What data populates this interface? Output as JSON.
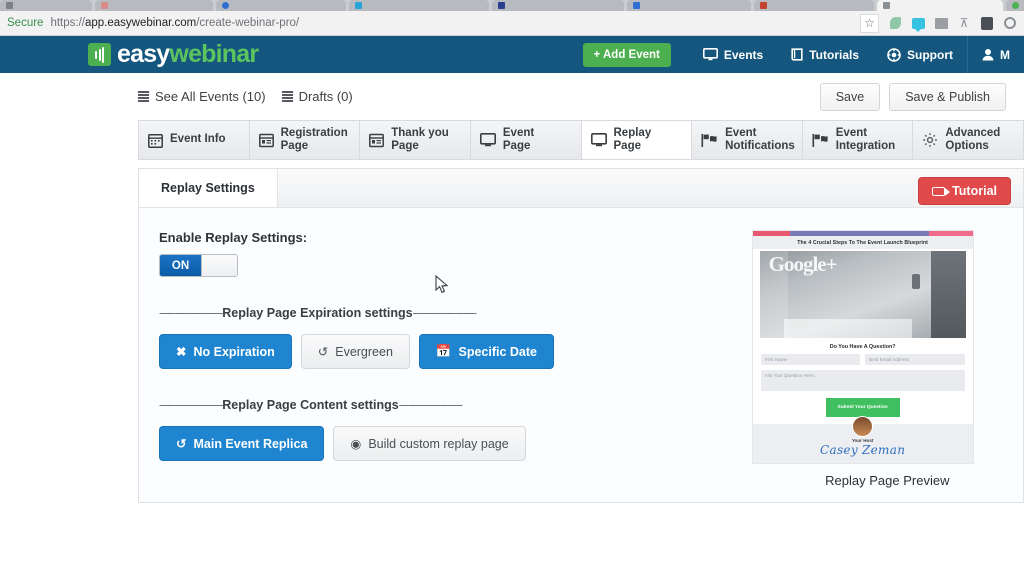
{
  "browser": {
    "tabs": [
      {
        "title": "",
        "favicon_color": "#7b8186"
      },
      {
        "title": "",
        "favicon_color": "#d98b8b"
      },
      {
        "title": "",
        "favicon_color": "#2f6fd0"
      },
      {
        "title": "",
        "favicon_color": "#29a3d8"
      },
      {
        "title": "",
        "favicon_color": "#2a3f8f"
      },
      {
        "title": "",
        "favicon_color": "#2f6fd0"
      },
      {
        "title": "",
        "favicon_color": "#c4452f"
      },
      {
        "title": "",
        "favicon_color": "#8a8f94"
      },
      {
        "title": "",
        "favicon_color": "#4caf50"
      },
      {
        "title": "",
        "favicon_color": "#8a8f94"
      },
      {
        "title": "",
        "favicon_color": "#8a8f94"
      }
    ],
    "security_label": "Secure",
    "url_scheme": "https://",
    "url_host": "app.easywebinar.com",
    "url_path": "/create-webinar-pro/",
    "icons": [
      "star-icon",
      "leaf-extension-icon",
      "chat-extension-icon",
      "card-extension-icon",
      "download-icon",
      "square-extension-icon",
      "circle-extension-icon"
    ]
  },
  "topnav": {
    "logo_easy": "easy",
    "logo_webinar": "webinar",
    "add_event": "+ Add Event",
    "items": [
      {
        "label": "Events",
        "icon": "monitor-icon"
      },
      {
        "label": "Tutorials",
        "icon": "book-icon"
      },
      {
        "label": "Support",
        "icon": "lifebuoy-icon"
      },
      {
        "label": "M",
        "icon": "user-icon"
      }
    ]
  },
  "subheader": {
    "crumbs": [
      {
        "label": "See All Events (10)"
      },
      {
        "label": "Drafts (0)"
      }
    ],
    "save": "Save",
    "save_publish": "Save & Publish"
  },
  "wizard_tabs": [
    {
      "label": "Event Info",
      "icon": "calendar-icon",
      "active": false
    },
    {
      "label": "Registration\nPage",
      "icon": "window-icon",
      "active": false
    },
    {
      "label": "Thank you\nPage",
      "icon": "window-icon",
      "active": false
    },
    {
      "label": "Event\nPage",
      "icon": "monitor-icon",
      "active": false
    },
    {
      "label": "Replay\nPage",
      "icon": "monitor-icon",
      "active": true
    },
    {
      "label": "Event\nNotifications",
      "icon": "flag-icon",
      "active": false
    },
    {
      "label": "Event\nIntegration",
      "icon": "flag-icon",
      "active": false
    },
    {
      "label": "Advanced\nOptions",
      "icon": "gear-icon",
      "active": false
    }
  ],
  "panel": {
    "tab_label": "Replay Settings",
    "tutorial_label": "Tutorial",
    "enable_label": "Enable Replay Settings:",
    "toggle_state": "ON",
    "expiration_divider_left": "--------------------",
    "expiration_divider_text": "Replay Page Expiration settings",
    "expiration_divider_right": "--------------------",
    "expiration_buttons": [
      {
        "label": "No Expiration",
        "icon": "x-icon",
        "selected": true
      },
      {
        "label": "Evergreen",
        "icon": "refresh-icon",
        "selected": false
      },
      {
        "label": "Specific Date",
        "icon": "calendar-icon",
        "selected": true
      }
    ],
    "content_divider_left": "--------------------",
    "content_divider_text": "Replay Page Content settings",
    "content_divider_right": "--------------------",
    "content_buttons": [
      {
        "label": "Main Event Replica",
        "icon": "refresh-icon",
        "selected": true
      },
      {
        "label": "Build custom replay page",
        "icon": "target-icon",
        "selected": false
      }
    ]
  },
  "preview": {
    "headline": "The 4 Crucial Steps To The Event Launch Blueprint",
    "video_watermark": "Google+",
    "question_heading": "Do You Have A Question?",
    "first_name_placeholder": "First Name",
    "email_placeholder": "Best Email Address",
    "question_placeholder": "Ask Your Question Here...",
    "submit_label": "Submit Your Question",
    "your_host_label": "Your Host",
    "host_name": "Casey Zeman",
    "caption": "Replay Page Preview"
  },
  "colors": {
    "brand_navy": "#14567d",
    "brand_green": "#4caf50",
    "accent_blue": "#1f85d0",
    "tutorial_red": "#e04a4a",
    "toggle_blue": "#0b5ca8"
  }
}
